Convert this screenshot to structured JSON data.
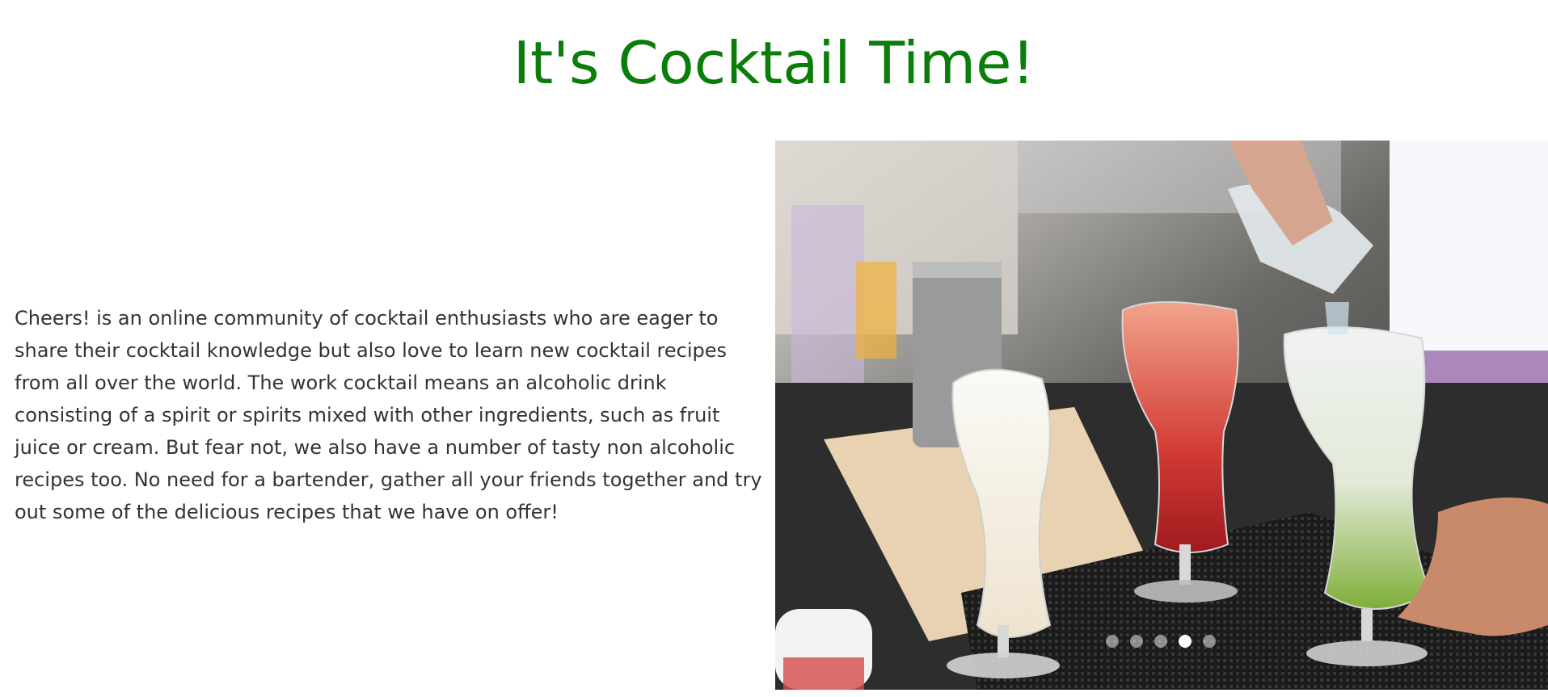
{
  "header": {
    "title": "It's Cocktail Time!"
  },
  "intro": {
    "text": "Cheers! is an online community of cocktail enthusiasts who are eager to share their cocktail knowledge but also love to learn new cocktail recipes from all over the world. The work cocktail means an alcoholic drink consisting of a spirit or spirits mixed with other ingredients, such as fruit juice or cream. But fear not, we also have a number of tasty non alcoholic recipes too. No need for a bartender, gather all your friends together and try out some of the delicious recipes that we have on offer!"
  },
  "carousel": {
    "slide_count": 5,
    "active_index": 3
  },
  "colors": {
    "title": "#0a7d0a",
    "text": "#333333"
  }
}
